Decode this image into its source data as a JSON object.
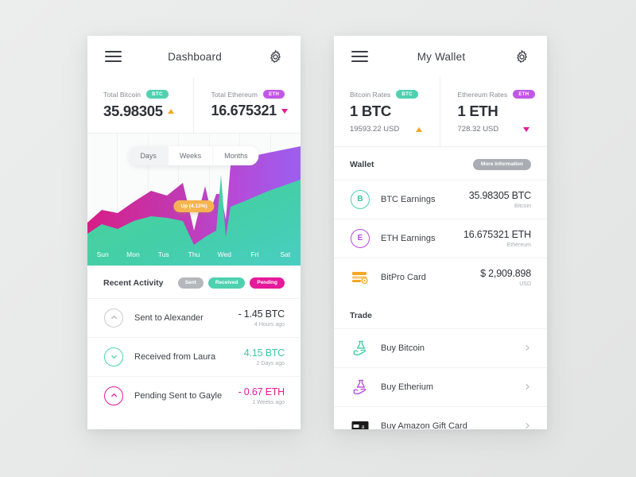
{
  "dashboard": {
    "title": "Dashboard",
    "totals": [
      {
        "label": "Total Bitcoin",
        "badge": "BTC",
        "value": "35.98305",
        "dir": "up"
      },
      {
        "label": "Total Ethereum",
        "badge": "ETH",
        "value": "16.675321",
        "dir": "down"
      }
    ],
    "segments": [
      {
        "label": "Days",
        "active": true
      },
      {
        "label": "Weeks",
        "active": false
      },
      {
        "label": "Months",
        "active": false
      }
    ],
    "chart_tooltip": "Up (4.13%)",
    "recent": {
      "title": "Recent Activity",
      "tags": [
        {
          "label": "Sent"
        },
        {
          "label": "Received"
        },
        {
          "label": "Pending"
        }
      ],
      "items": [
        {
          "icon": "arrow-up-circle-icon",
          "name": "Sent to Alexander",
          "amount": "- 1.45 BTC",
          "time": "4 Hours ago",
          "color": "dark"
        },
        {
          "icon": "arrow-down-circle-icon",
          "name": "Received from Laura",
          "amount": "4.15 BTC",
          "time": "2 Days ago",
          "color": "teal"
        },
        {
          "icon": "arrow-up-circle-icon",
          "name": "Pending Sent to Gayle",
          "amount": "- 0.67 ETH",
          "time": "1 Weeks ago",
          "color": "pink"
        }
      ]
    }
  },
  "wallet": {
    "title": "My Wallet",
    "rates": [
      {
        "label": "Bitcoin Rates",
        "badge": "BTC",
        "value": "1 BTC",
        "usd": "19593.22 USD",
        "dir": "up"
      },
      {
        "label": "Ethereum Rates",
        "badge": "ETH",
        "value": "1 ETH",
        "usd": "728.32 USD",
        "dir": "down"
      }
    ],
    "wallet_section": {
      "title": "Wallet",
      "action": "More information",
      "items": [
        {
          "icon": "bitcoin-circle-icon",
          "glyph": "B",
          "name": "BTC Earnings",
          "amount": "35.98305 BTC",
          "sub": "Bitcoin"
        },
        {
          "icon": "ethereum-circle-icon",
          "glyph": "E",
          "name": "ETH Earnings",
          "amount": "16.675321 ETH",
          "sub": "Ethereum"
        },
        {
          "icon": "credit-card-icon",
          "glyph": "",
          "name": "BitPro Card",
          "amount": "$ 2,909.898",
          "sub": "USD"
        }
      ]
    },
    "trade_section": {
      "title": "Trade",
      "items": [
        {
          "icon": "hand-coin-teal-icon",
          "name": "Buy Bitcoin"
        },
        {
          "icon": "hand-coin-purple-icon",
          "name": "Buy Etherium"
        },
        {
          "icon": "amazon-gift-card-icon",
          "name": "Buy Amazon Gift Card"
        }
      ]
    }
  },
  "chart_data": {
    "type": "area",
    "title": "",
    "categories": [
      "Sun",
      "Mon",
      "Tus",
      "Thu",
      "Wed",
      "Fri",
      "Sat"
    ],
    "xlabel": "",
    "ylabel": "",
    "legend_position": "none",
    "grid": true,
    "annotation": "Up (4.13%)",
    "series": [
      {
        "name": "Bitcoin",
        "color": "#3ecfa0",
        "x": [
          0,
          0.5,
          1,
          1.5,
          2,
          2.5,
          3,
          3.3,
          3.6,
          3.8,
          4,
          4.2,
          4.4,
          4.6,
          5,
          5.5,
          6
        ],
        "values": [
          38,
          48,
          42,
          52,
          57,
          56,
          52,
          22,
          30,
          34,
          28,
          62,
          30,
          18,
          70,
          80,
          88
        ]
      },
      {
        "name": "Ethereum",
        "color": "#c53bb0",
        "x": [
          0,
          0.5,
          1,
          1.5,
          2,
          2.5,
          3,
          3.3,
          3.6,
          3.8,
          4,
          4.2,
          4.4,
          4.6,
          5,
          5.5,
          6
        ],
        "values": [
          46,
          54,
          50,
          62,
          70,
          66,
          78,
          22,
          74,
          50,
          62,
          62,
          34,
          88,
          96,
          100,
          104
        ]
      }
    ],
    "ylim": [
      0,
      110
    ]
  }
}
